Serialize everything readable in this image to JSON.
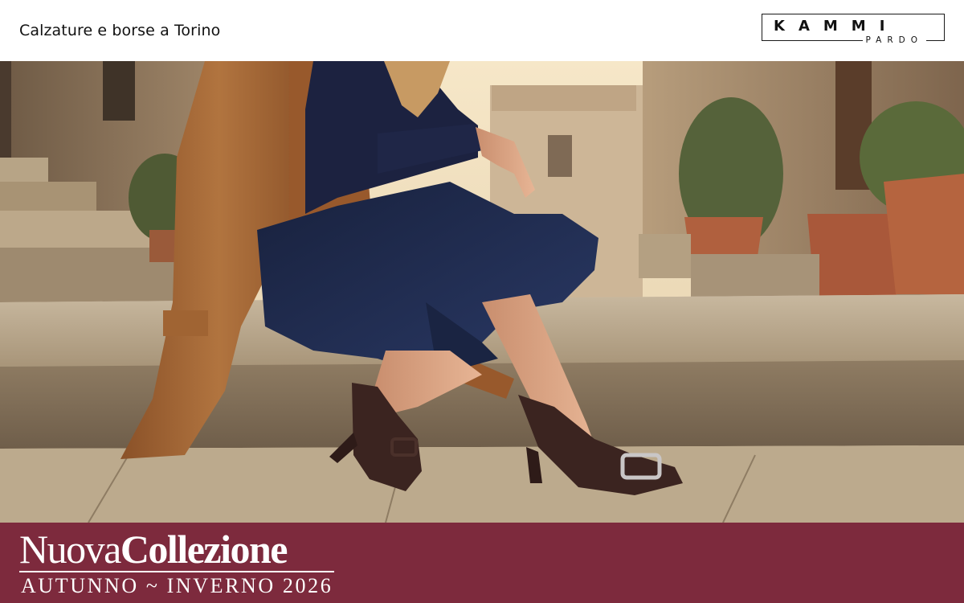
{
  "header": {
    "tagline": "Calzature e borse a Torino",
    "logo": {
      "main": "KAMMI",
      "sub": "PARDO"
    }
  },
  "hero": {
    "scene": "woman seated on stone steps in an old town street wearing camel coat, navy knit, dark jeans and brown suede pumps with buckle",
    "colors": {
      "stone": "#b9a690",
      "coat": "#a8693a",
      "denim": "#1f2a4a",
      "shoe": "#3b2420",
      "sky": "#f3e3c4"
    }
  },
  "banner": {
    "headline_part1": "Nuova",
    "headline_part2": "Collezione",
    "subline": "AUTUNNO ~ INVERNO 2026",
    "background": "#7d2a3d"
  }
}
